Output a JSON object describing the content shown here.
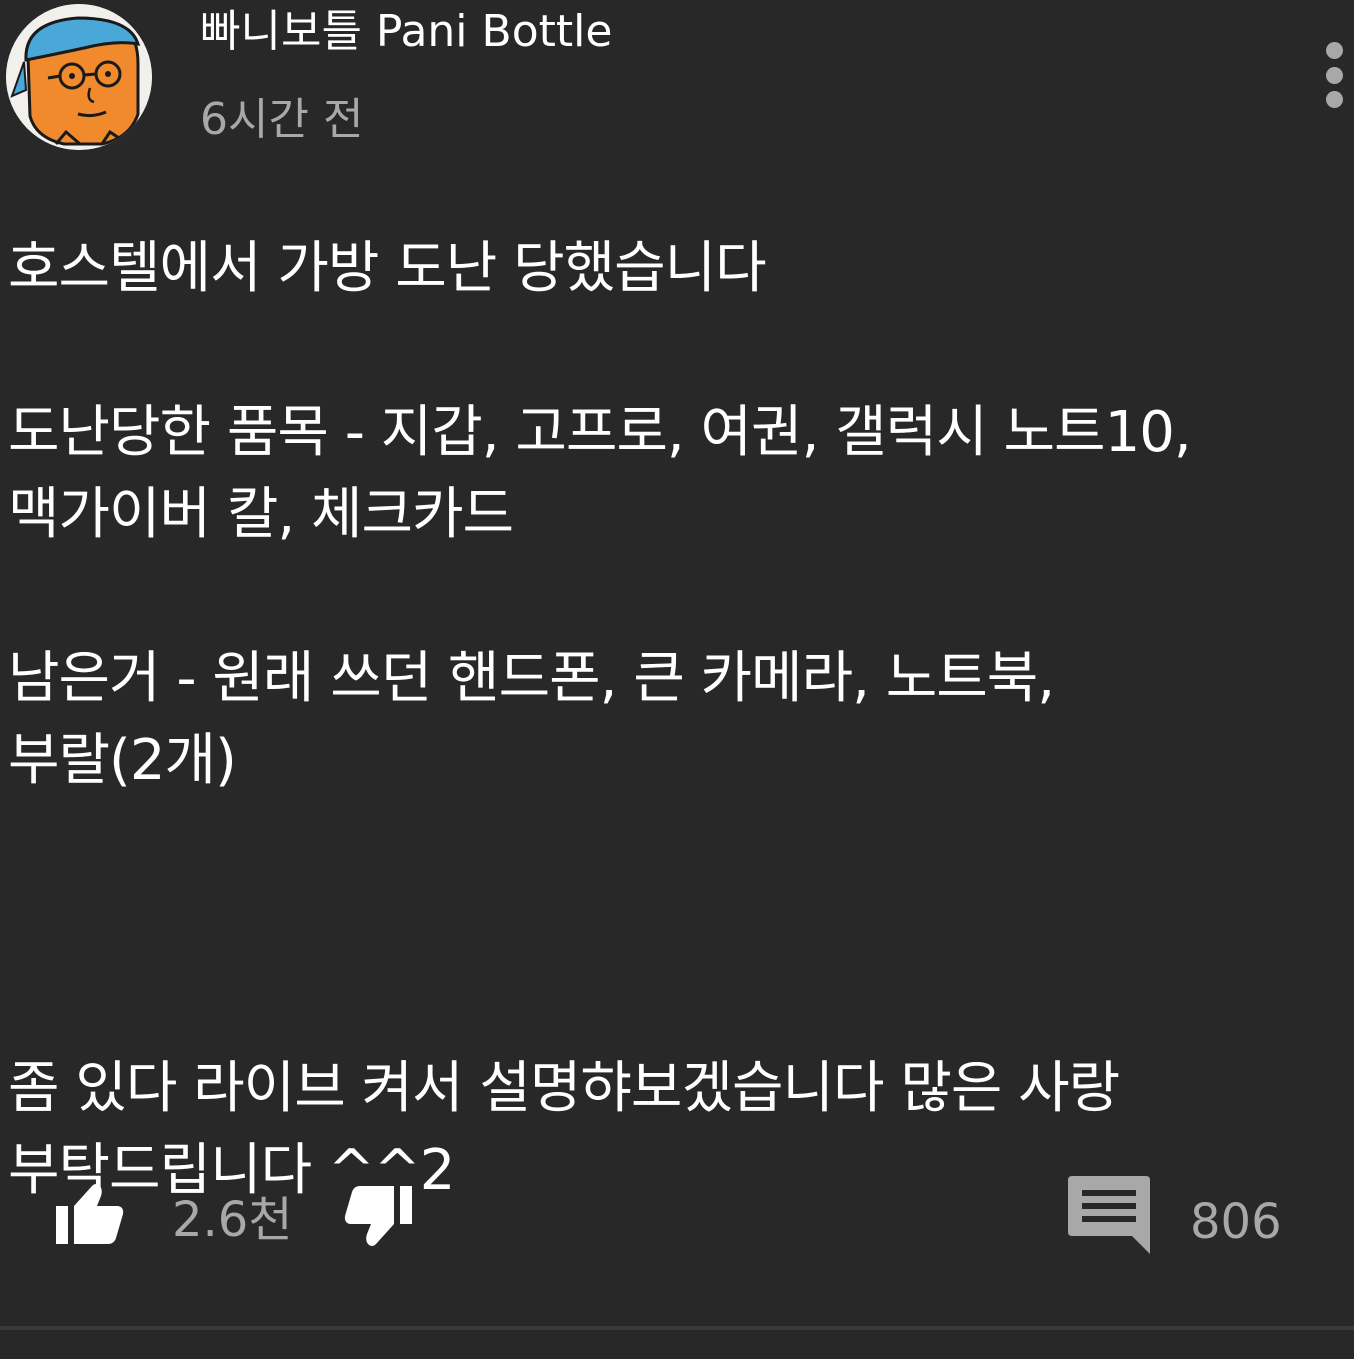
{
  "comment": {
    "author": "빠니보틀 Pani Bottle",
    "timestamp": "6시간 전",
    "body_lines": [
      "호스텔에서 가방 도난 당했습니다",
      "",
      "도난당한 품목 - 지갑, 고프로, 여권, 갤럭시 노트10,",
      "맥가이버 칼, 체크카드",
      "",
      "남은거 - 원래 쓰던 핸드폰, 큰 카메라, 노트북,",
      "부랄(2개)",
      "",
      "",
      "",
      "좀 있다 라이브 켜서 설명햐보겠습니다 많은 사랑",
      "부탁드립니다 ^^2"
    ]
  },
  "actions": {
    "like_count": "2.6천",
    "reply_count": "806"
  },
  "icons": {
    "like": "thumbs-up-icon",
    "dislike": "thumbs-down-icon",
    "reply": "comment-icon",
    "menu": "more-vertical-icon"
  },
  "colors": {
    "background": "#282828",
    "text_primary": "#ffffff",
    "text_secondary": "#a8a8a8",
    "avatar_orange": "#f08a2c",
    "avatar_cap": "#4aa8d8"
  }
}
